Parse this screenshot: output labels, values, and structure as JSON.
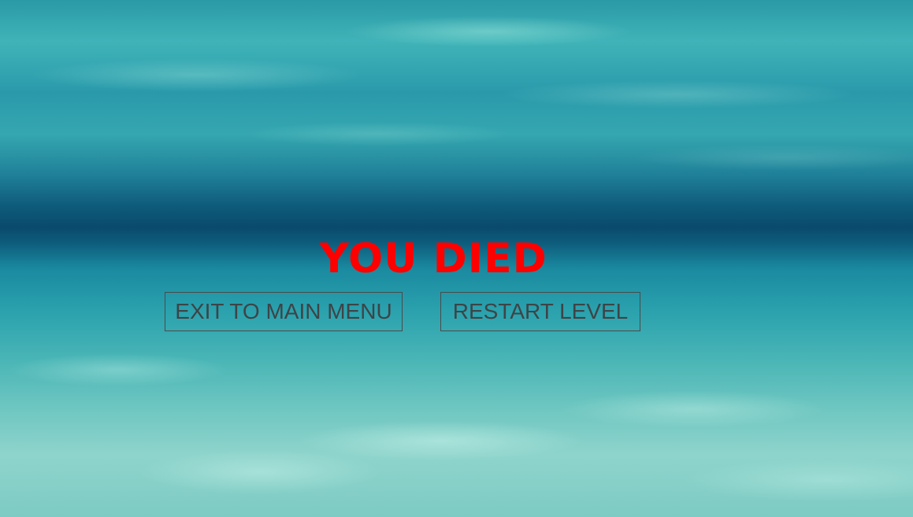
{
  "screen": {
    "title": "YOU DIED",
    "title_color": "#ff0000"
  },
  "buttons": {
    "exit_label": "EXIT TO MAIN MENU",
    "restart_label": "RESTART LEVEL"
  },
  "background": {
    "scene": "underwater"
  }
}
